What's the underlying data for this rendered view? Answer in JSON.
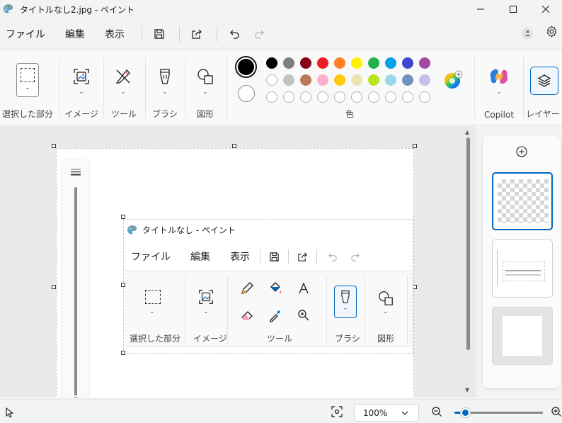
{
  "window": {
    "title": "タイトルなし2.jpg - ペイント",
    "icon": "paint-palette-icon"
  },
  "menu": {
    "file": "ファイル",
    "edit": "編集",
    "view": "表示"
  },
  "ribbon": {
    "selection_label": "選択した部分",
    "image_label": "イメージ",
    "tools_label": "ツール",
    "brushes_label": "ブラシ",
    "shapes_label": "図形",
    "colors_label": "色",
    "copilot_label": "Copilot",
    "layers_label": "レイヤー",
    "colors": {
      "primary": "#000000",
      "secondary": "#ffffff",
      "row1": [
        "#000000",
        "#7f7f7f",
        "#880015",
        "#ed1c24",
        "#ff7f27",
        "#fff200",
        "#22b14c",
        "#00a2e8",
        "#3f48cc",
        "#a349a4"
      ],
      "row2": [
        "#ffffff",
        "#c3c3c3",
        "#b97a57",
        "#ffaec9",
        "#ffc90e",
        "#efe4b0",
        "#b5e61d",
        "#99d9ea",
        "#7092be",
        "#c8bfe7"
      ]
    }
  },
  "inner": {
    "title": "タイトルなし - ペイント",
    "menu": {
      "file": "ファイル",
      "edit": "編集",
      "view": "表示"
    },
    "selection_label": "選択した部分",
    "image_label": "イメージ",
    "tools_label": "ツール",
    "brushes_label": "ブラシ",
    "shapes_label": "図形"
  },
  "status": {
    "zoom_value": "100%",
    "zoom_level": 0.13
  }
}
